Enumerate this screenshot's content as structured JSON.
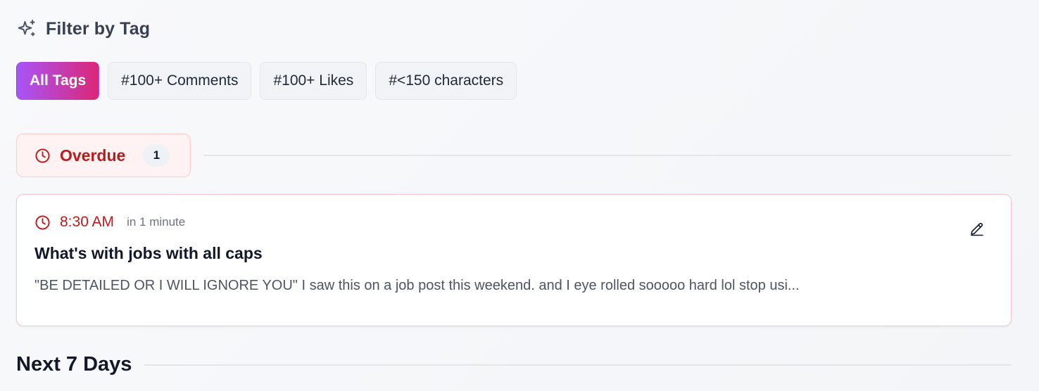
{
  "filter": {
    "title": "Filter by Tag",
    "icon": "sparkles-icon",
    "tags": [
      {
        "label": "All Tags",
        "active": true
      },
      {
        "label": "#100+ Comments",
        "active": false
      },
      {
        "label": "#100+ Likes",
        "active": false
      },
      {
        "label": "#<150 characters",
        "active": false
      }
    ]
  },
  "overdue": {
    "label": "Overdue",
    "count": "1",
    "icon": "clock-icon",
    "color": "#b91c1c"
  },
  "post": {
    "time": "8:30 AM",
    "relative": "in 1 minute",
    "title": "What's with jobs with all caps",
    "body": "\"BE DETAILED OR I WILL IGNORE YOU\" I saw this on a job post this weekend. and I eye rolled sooooo hard lol stop usi...",
    "edit_icon": "pencil-icon"
  },
  "next": {
    "title": "Next 7 Days"
  },
  "colors": {
    "accent_gradient_start": "#a855f7",
    "accent_gradient_end": "#db2777",
    "overdue_red": "#b91c1c"
  }
}
